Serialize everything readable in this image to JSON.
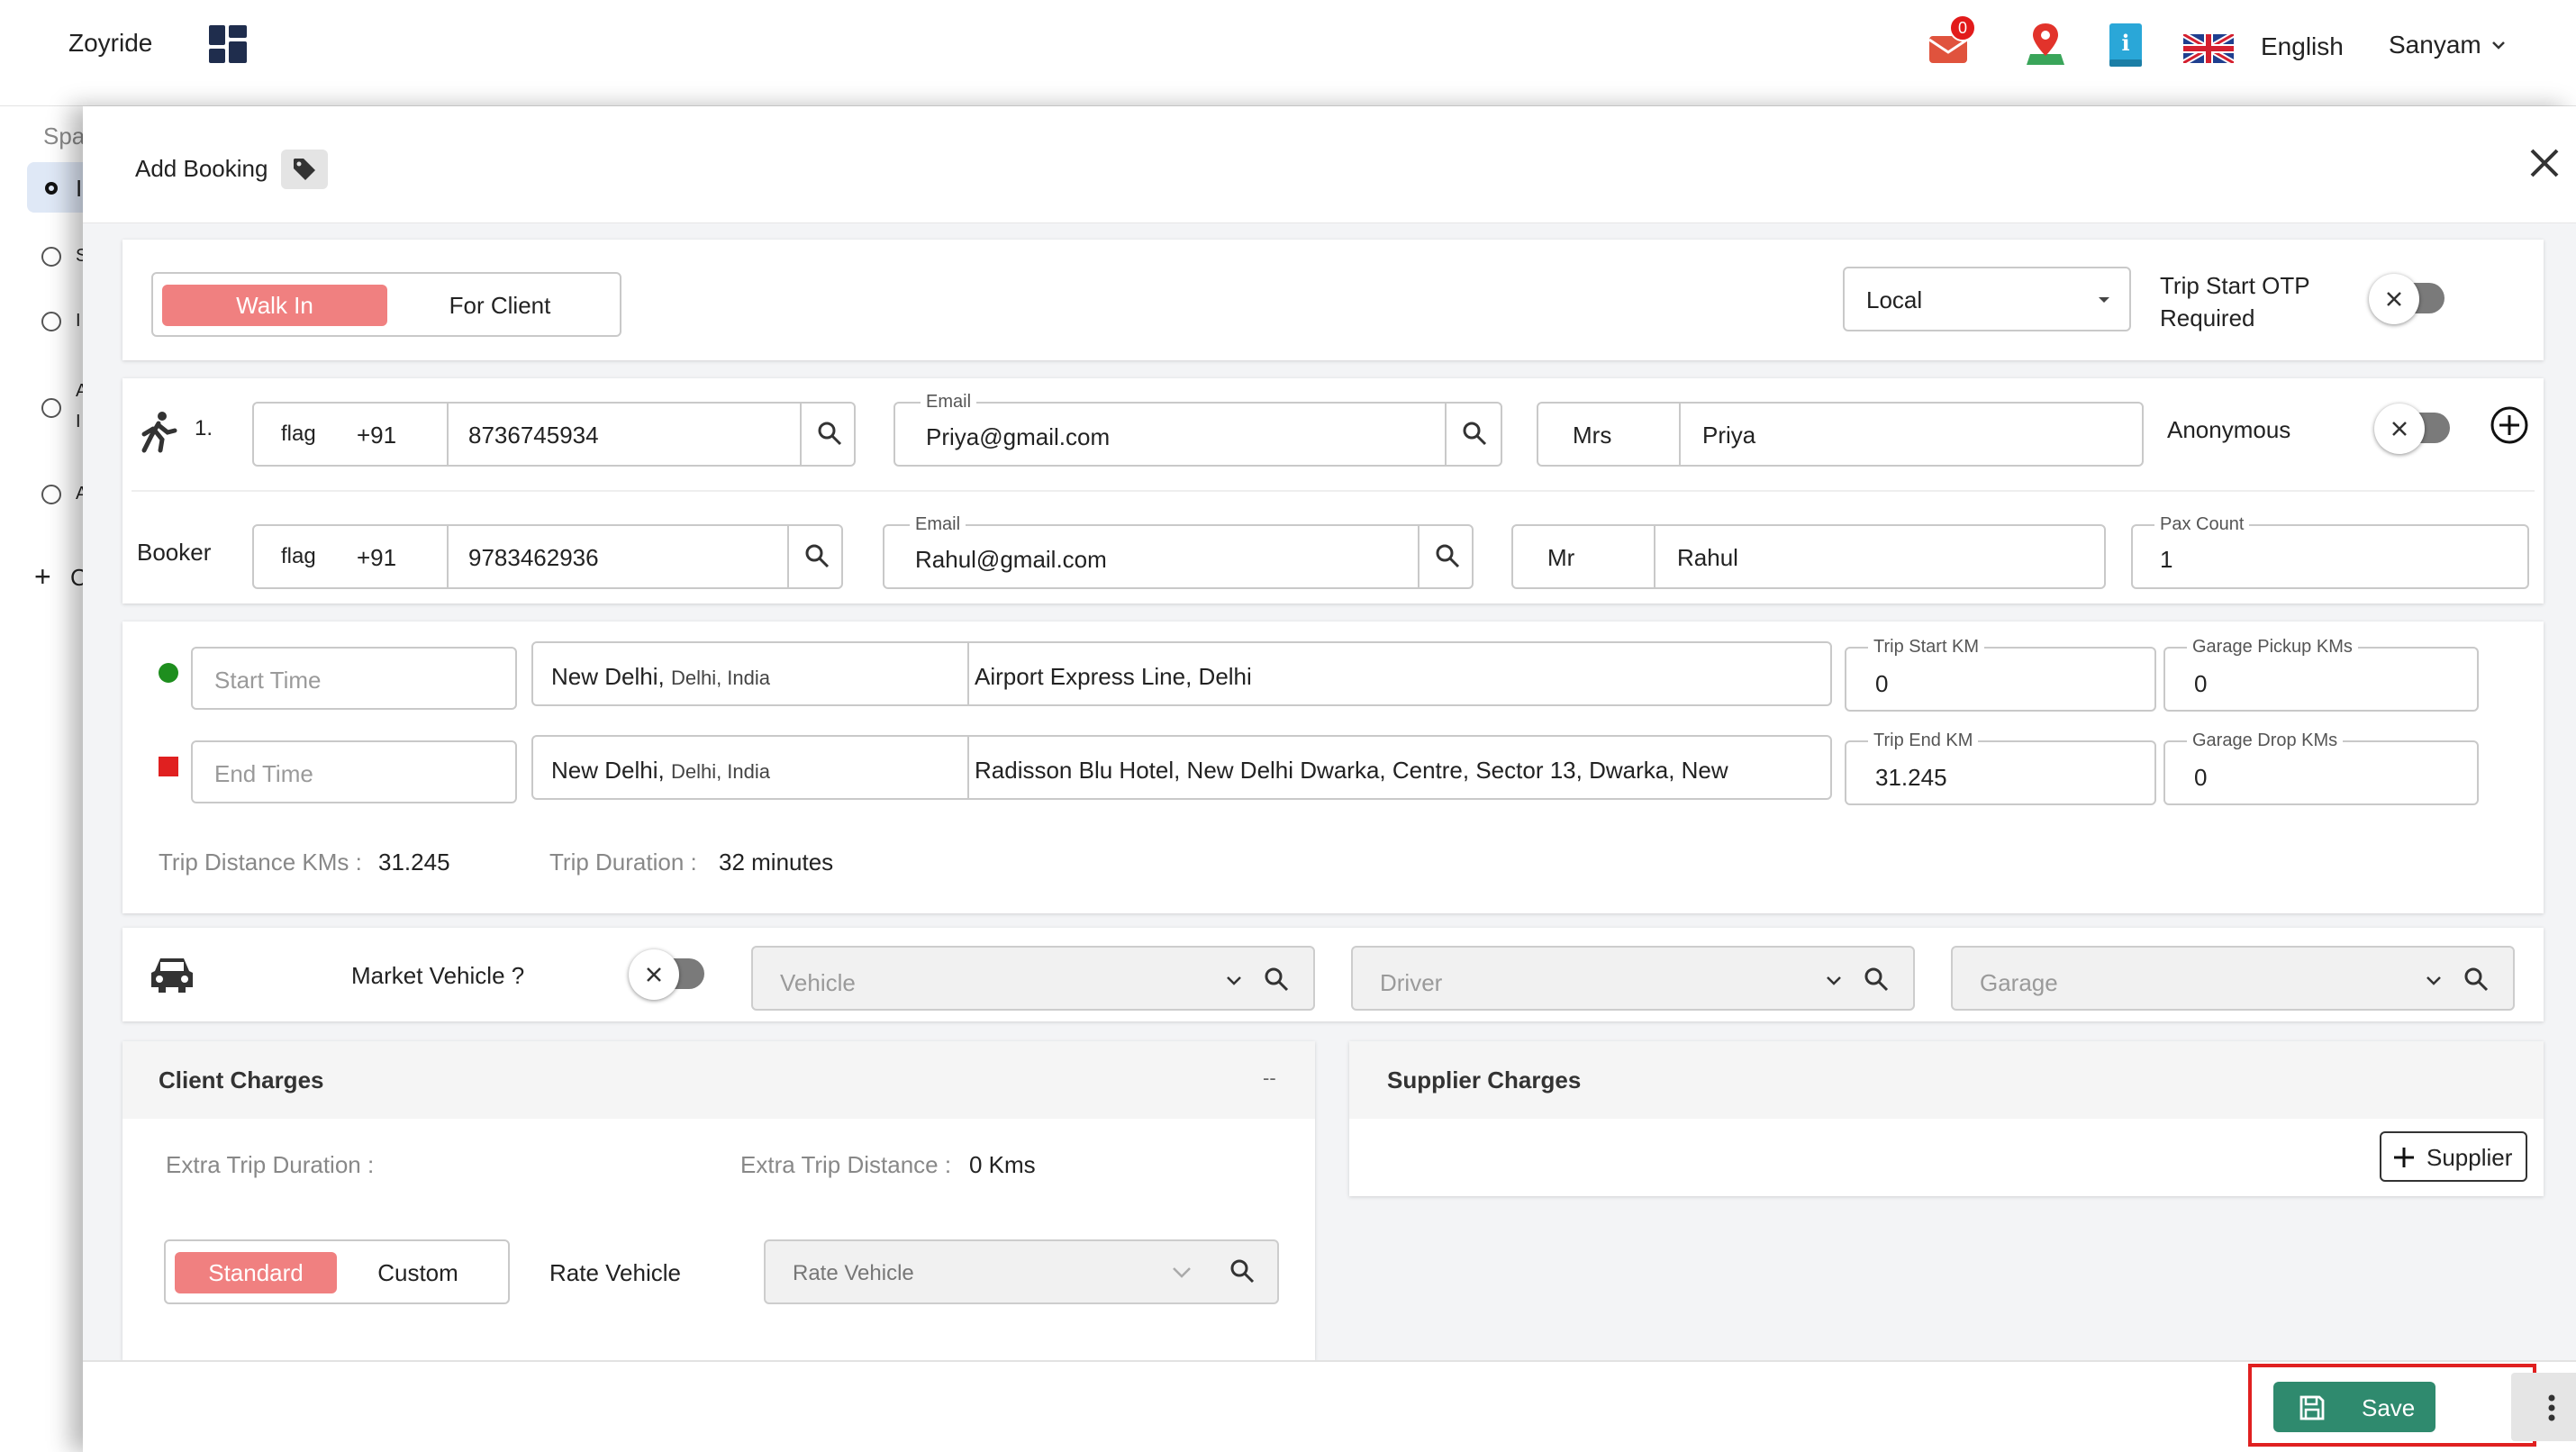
{
  "topbar": {
    "brand": "Zoyride",
    "notification_count": "0",
    "language": "English",
    "user": "Sanyam"
  },
  "sidebar": {
    "labels": [
      "Spa",
      "I",
      "S",
      "I",
      "A",
      "I",
      "A",
      "C"
    ]
  },
  "modal": {
    "title": "Add Booking",
    "booking_type_tabs": [
      "Walk In",
      "For Client"
    ],
    "trip_type": "Local",
    "trip_otp_label_1": "Trip Start OTP",
    "trip_otp_label_2": "Required"
  },
  "passenger": {
    "index": "1.",
    "flag_alt": "flag",
    "country_code": "+91",
    "phone": "8736745934",
    "email_label": "Email",
    "email": "Priya@gmail.com",
    "salutation": "Mrs",
    "name": "Priya",
    "anonymous_label": "Anonymous"
  },
  "booker": {
    "label": "Booker",
    "flag_alt": "flag",
    "country_code": "+91",
    "phone": "9783462936",
    "email_label": "Email",
    "email": "Rahul@gmail.com",
    "salutation": "Mr",
    "name": "Rahul",
    "pax_label": "Pax Count",
    "pax_count": "1"
  },
  "trip": {
    "start_time_placeholder": "Start Time",
    "end_time_placeholder": "End Time",
    "pickup_city": "New Delhi,",
    "pickup_region": "Delhi, India",
    "pickup_address": "Airport Express Line, Delhi",
    "drop_city": "New Delhi,",
    "drop_region": "Delhi, India",
    "drop_address": "Radisson Blu Hotel, New Delhi Dwarka, Centre, Sector 13, Dwarka, New",
    "start_km_label": "Trip Start KM",
    "start_km": "0",
    "garage_pickup_label": "Garage Pickup KMs",
    "garage_pickup": "0",
    "end_km_label": "Trip End KM",
    "end_km": "31.245",
    "garage_drop_label": "Garage Drop KMs",
    "garage_drop": "0",
    "distance_label": "Trip Distance KMs :",
    "distance_value": "31.245",
    "duration_label": "Trip Duration :",
    "duration_value": "32 minutes",
    "start_marker_color": "#1e8e1e",
    "end_marker_color": "#e02020"
  },
  "vehicle_row": {
    "market_vehicle_label": "Market Vehicle ?",
    "vehicle_placeholder": "Vehicle",
    "driver_placeholder": "Driver",
    "garage_placeholder": "Garage"
  },
  "client_charges": {
    "title": "Client Charges",
    "collapse": "--",
    "extra_duration_label": "Extra Trip Duration :",
    "extra_distance_label": "Extra Trip Distance :",
    "extra_distance_value": "0 Kms",
    "rate_tabs": [
      "Standard",
      "Custom"
    ],
    "rate_vehicle_label": "Rate Vehicle",
    "rate_vehicle_placeholder": "Rate Vehicle"
  },
  "supplier_charges": {
    "title": "Supplier Charges",
    "add_supplier": "Supplier"
  },
  "footer": {
    "save_label": "Save",
    "accent": "#2f8a6e",
    "highlight": "#e02020"
  }
}
